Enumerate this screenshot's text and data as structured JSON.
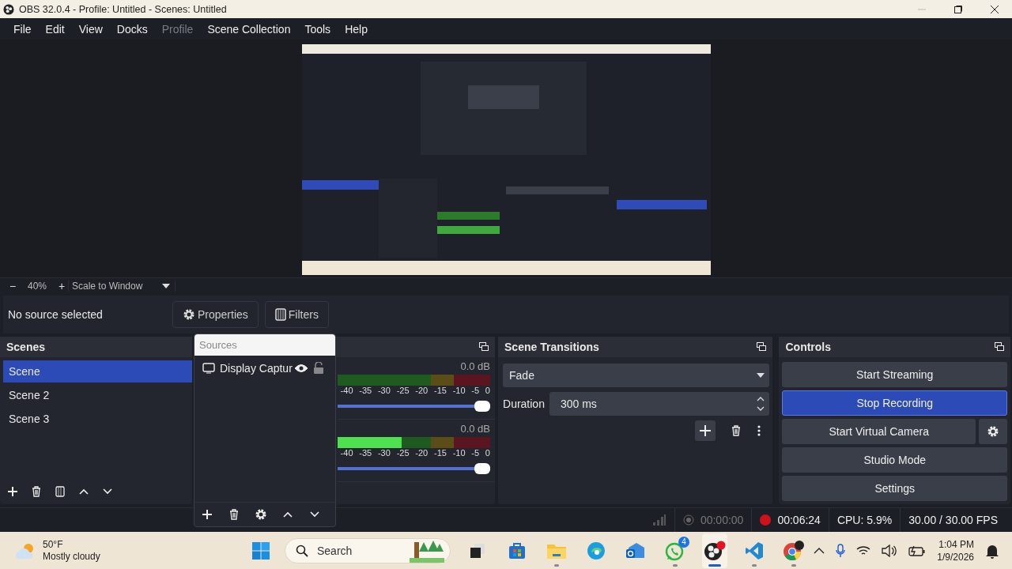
{
  "window": {
    "title": "OBS 32.0.4 - Profile: Untitled - Scenes: Untitled"
  },
  "menu": [
    {
      "label": "File",
      "disabled": false
    },
    {
      "label": "Edit",
      "disabled": false
    },
    {
      "label": "View",
      "disabled": false
    },
    {
      "label": "Docks",
      "disabled": false
    },
    {
      "label": "Profile",
      "disabled": true
    },
    {
      "label": "Scene Collection",
      "disabled": false
    },
    {
      "label": "Tools",
      "disabled": false
    },
    {
      "label": "Help",
      "disabled": false
    }
  ],
  "zoom_bar": {
    "zoom_out": "−",
    "zoom": "40%",
    "zoom_in": "+",
    "scale_mode": "Scale to Window"
  },
  "context_bar": {
    "status": "No source selected",
    "buttons": [
      {
        "label": "Properties",
        "kind": "properties"
      },
      {
        "label": "Filters",
        "kind": "filters"
      }
    ]
  },
  "scenes": {
    "title": "Scenes",
    "items": [
      {
        "label": "Scene",
        "selected": true
      },
      {
        "label": "Scene 2",
        "selected": false
      },
      {
        "label": "Scene 3",
        "selected": false
      }
    ]
  },
  "sources": {
    "title": "Sources",
    "items": [
      {
        "label": "Display Captur",
        "visible": true,
        "locked": false
      }
    ]
  },
  "mixer": {
    "channels": [
      {
        "reading": "0.0 dB",
        "meter": {
          "level": 0
        },
        "fader": {
          "level": 1
        },
        "scale": [
          "-40",
          "-35",
          "-30",
          "-25",
          "-20",
          "-15",
          "-10",
          "-5",
          "0"
        ]
      },
      {
        "reading": "0.0 dB",
        "meter": {
          "level": 0.42
        },
        "fader": {
          "level": 1
        },
        "scale": [
          "-40",
          "-35",
          "-30",
          "-25",
          "-20",
          "-15",
          "-10",
          "-5",
          "0"
        ]
      }
    ]
  },
  "transitions": {
    "title": "Scene Transitions",
    "transition": "Fade",
    "duration_label": "Duration",
    "duration": "300 ms"
  },
  "controls": {
    "title": "Controls",
    "buttons": [
      {
        "label": "Start Streaming",
        "active": false,
        "kind": "plain"
      },
      {
        "label": "Stop Recording",
        "active": true,
        "kind": "plain"
      },
      {
        "label": "Start Virtual Camera",
        "active": false,
        "kind": "with_settings"
      },
      {
        "label": "Studio Mode",
        "active": false,
        "kind": "plain"
      },
      {
        "label": "Settings",
        "active": false,
        "kind": "plain"
      }
    ]
  },
  "status_bar": {
    "stream_time": "00:00:00",
    "recording": true,
    "record_time": "00:06:24",
    "cpu": "CPU: 5.9%",
    "fps": "30.00 / 30.00 FPS"
  },
  "taskbar": {
    "weather_temp": "50°F",
    "weather_text": "Mostly cloudy",
    "search_placeholder": "Search",
    "apps": [
      {
        "kind": "taskview",
        "running": false,
        "active": false
      },
      {
        "kind": "store",
        "running": false,
        "active": false
      },
      {
        "kind": "explorer",
        "running": true,
        "active": false
      },
      {
        "kind": "edge",
        "running": false,
        "active": false
      },
      {
        "kind": "outlook",
        "running": false,
        "active": false
      },
      {
        "kind": "whatsapp",
        "running": true,
        "active": false,
        "badge": "4"
      },
      {
        "kind": "obs",
        "running": true,
        "active": true
      },
      {
        "kind": "vscode",
        "running": true,
        "active": false
      },
      {
        "kind": "chrome",
        "running": true,
        "active": false
      }
    ],
    "time": "1:04 PM",
    "date": "1/9/2026"
  }
}
